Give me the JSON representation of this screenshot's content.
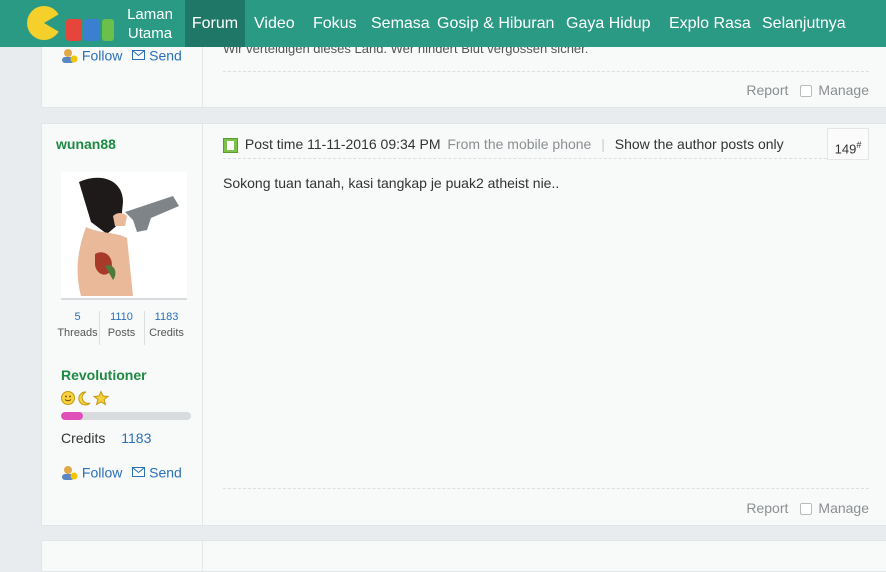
{
  "nav": {
    "home_line1": "Laman",
    "home_line2": "Utama",
    "items": [
      "Forum",
      "Video",
      "Fokus",
      "Semasa",
      "Gosip & Hiburan",
      "Gaya Hidup",
      "Explo Rasa",
      "Selanjutnya"
    ]
  },
  "prev_post": {
    "follow_label": "Follow",
    "send_label": "Send",
    "text": "Wir verteidigen dieses Land. Wer hindert Blut vergossen sicher.",
    "report_label": "Report",
    "manage_label": "Manage"
  },
  "post": {
    "username": "wunan88",
    "post_time": "Post time 11-11-2016 09:34 PM",
    "source": "From the mobile phone",
    "author_only": "Show the author posts only",
    "floor": "149",
    "floor_mark": "#",
    "body": "Sokong tuan tanah, kasi tangkap je puak2 atheist nie..",
    "stats": [
      {
        "value": "5",
        "label": "Threads"
      },
      {
        "value": "1110",
        "label": "Posts"
      },
      {
        "value": "1183",
        "label": "Credits"
      }
    ],
    "rank": "Revolutioner",
    "progress": 0.17,
    "credits_label": "Credits",
    "credits_value": "1183",
    "follow_label": "Follow",
    "send_label": "Send",
    "report_label": "Report",
    "manage_label": "Manage"
  },
  "colors": {
    "nav_bg": "#2a9a84",
    "nav_active": "#1f7767",
    "username": "#1c8a42",
    "link": "#2a70b8",
    "progress": "#e04fb7"
  }
}
